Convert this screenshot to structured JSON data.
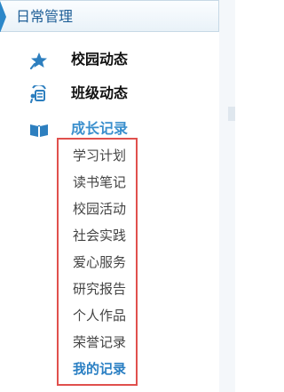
{
  "header": {
    "title": "日常管理"
  },
  "nav": {
    "items": [
      {
        "label": "校园动态",
        "icon": "star-pin-icon"
      },
      {
        "label": "班级动态",
        "icon": "class-dynamics-icon"
      },
      {
        "label": "成长记录",
        "icon": "open-book-icon",
        "active": true
      }
    ]
  },
  "submenu": {
    "items": [
      "学习计划",
      "读书笔记",
      "校园活动",
      "社会实践",
      "爱心服务",
      "研究报告",
      "个人作品",
      "荣誉记录",
      "我的记录"
    ],
    "selected_index": 8
  },
  "colors": {
    "accent": "#2b87c9",
    "header_text": "#1f5f97",
    "active": "#3a8fcd",
    "highlight_box": "#e0504d"
  }
}
